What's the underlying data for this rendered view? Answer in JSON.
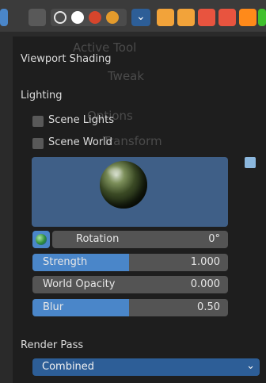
{
  "popup": {
    "title": "Viewport Shading",
    "section_lighting": "Lighting",
    "checkbox_scene_lights": "Scene Lights",
    "checkbox_scene_world": "Scene World",
    "rotation_label": "Rotation",
    "rotation_value": "0°",
    "strength_label": "Strength",
    "strength_value": "1.000",
    "world_opacity_label": "World Opacity",
    "world_opacity_value": "0.000",
    "blur_label": "Blur",
    "blur_value": "0.50",
    "render_pass_label": "Render Pass",
    "render_pass_value": "Combined"
  },
  "ghost": {
    "active_tool": "Active Tool",
    "tweak": "Tweak",
    "options": "Options",
    "transform": "Transform"
  },
  "icons": {
    "top_toolbar": [
      "view-mode-icon",
      "overlay-icon",
      "solid-shading-icon",
      "material-preview-icon",
      "render-preview-icon",
      "scene-icon",
      "house-icon",
      "home-icon",
      "window-icon",
      "stop-icon",
      "green-square-icon"
    ],
    "chevron": "chevron-down-icon"
  },
  "colors": {
    "accent": "#4a86c9",
    "dropdown": "#2d5e97"
  }
}
